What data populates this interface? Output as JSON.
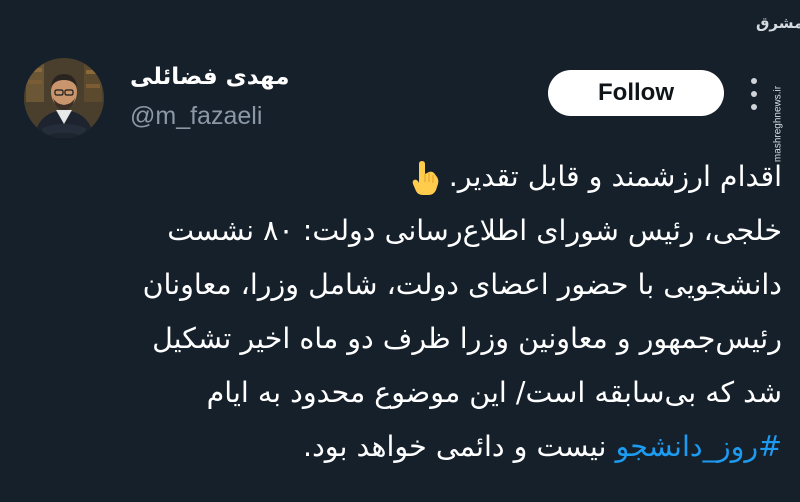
{
  "watermark": {
    "logo": "مشرق",
    "url": "mashreghnews.ir"
  },
  "profile": {
    "name": "مهدی فضائلی",
    "handle": "@m_fazaeli",
    "follow_label": "Follow"
  },
  "tweet": {
    "line1": "اقدام ارزشمند و قابل تقدیر.",
    "line2": "خلجی، رئیس شورای اطلاع‌رسانی دولت: ۸۰ نشست",
    "line3": "دانشجویی با حضور اعضای دولت، شامل وزرا، معاونان",
    "line4": "رئیس‌جمهور و معاونین وزرا ظرف دو ماه اخیر تشکیل",
    "line5": "شد که بی‌سابقه است/ این موضوع محدود به ایام",
    "hashtag": "#روز_دانشجو",
    "line6_rest": " نیست و دائمی خواهد بود."
  },
  "colors": {
    "background": "#15202b",
    "hashtag": "#1d9bf0",
    "handle": "#8b98a5"
  },
  "icons": {
    "emoji": "backhand-index-pointing-down",
    "more": "more-vertical-icon"
  }
}
